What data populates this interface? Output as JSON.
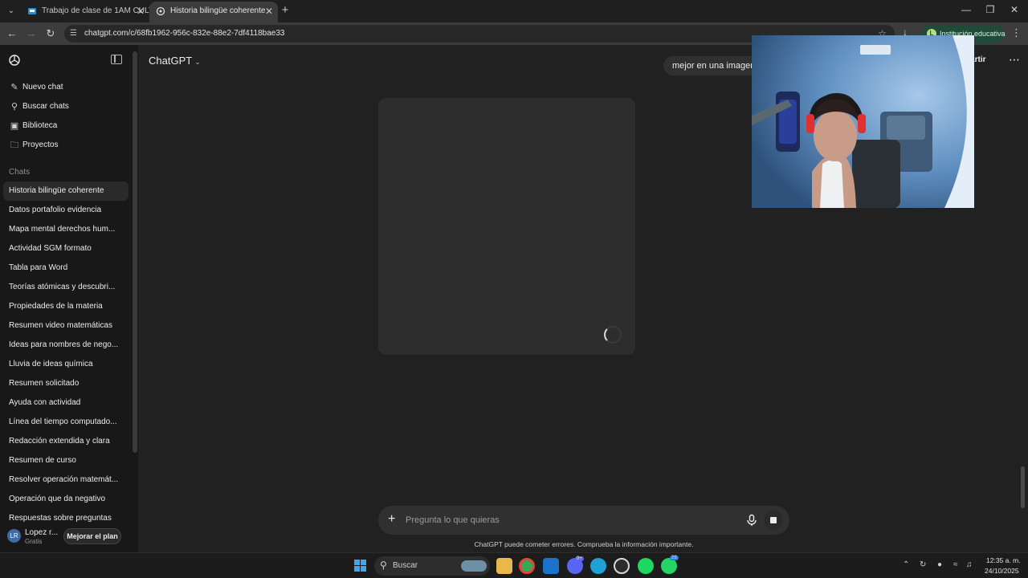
{
  "browser": {
    "tabs": [
      {
        "title": "Trabajo de clase de 1AM CULTU",
        "active": false
      },
      {
        "title": "Historia bilingüe coherente",
        "active": true
      }
    ],
    "url": "chatgpt.com/c/68fb1962-956c-832e-88e2-7df4118bae33",
    "profile_label": "Institución educativa",
    "profile_initial": "L"
  },
  "sidebar": {
    "nav": [
      {
        "label": "Nuevo chat",
        "icon": "edit-icon"
      },
      {
        "label": "Buscar chats",
        "icon": "search-icon"
      },
      {
        "label": "Biblioteca",
        "icon": "library-icon"
      },
      {
        "label": "Proyectos",
        "icon": "folder-icon"
      }
    ],
    "section_label": "Chats",
    "chats": [
      "Historia bilingüe coherente",
      "Datos portafolio evidencia",
      "Mapa mental derechos hum...",
      "Actividad SGM formato",
      "Tabla para Word",
      "Teorías atómicas y descubri...",
      "Propiedades de la materia",
      "Resumen video matemáticas",
      "Ideas para nombres de nego...",
      "Lluvia de ideas química",
      "Resumen solicitado",
      "Ayuda con actividad",
      "Línea del tiempo computado...",
      "Redacción extendida y clara",
      "Resumen de curso",
      "Resolver operación matemát...",
      "Operación que da negativo",
      "Respuestas sobre preguntas"
    ],
    "user": {
      "initials": "LR",
      "name": "Lopez r...",
      "plan": "Gratis",
      "upgrade_label": "Mejorar el plan"
    }
  },
  "main": {
    "model_label": "ChatGPT",
    "user_message": "mejor en una imagen",
    "share_label": "partir",
    "composer_placeholder": "Pregunta lo que quieras",
    "disclaimer": "ChatGPT puede cometer errores. Comprueba la información importante."
  },
  "taskbar": {
    "search_label": "Buscar",
    "time": "12:35 a. m.",
    "date": "24/10/2025",
    "badges": {
      "discord": "9+",
      "whatsapp": "29"
    }
  },
  "colors": {
    "sidebar_bg": "#181818",
    "main_bg": "#212121",
    "composer_bg": "#303030",
    "profile_chip": "#1e4a37"
  }
}
